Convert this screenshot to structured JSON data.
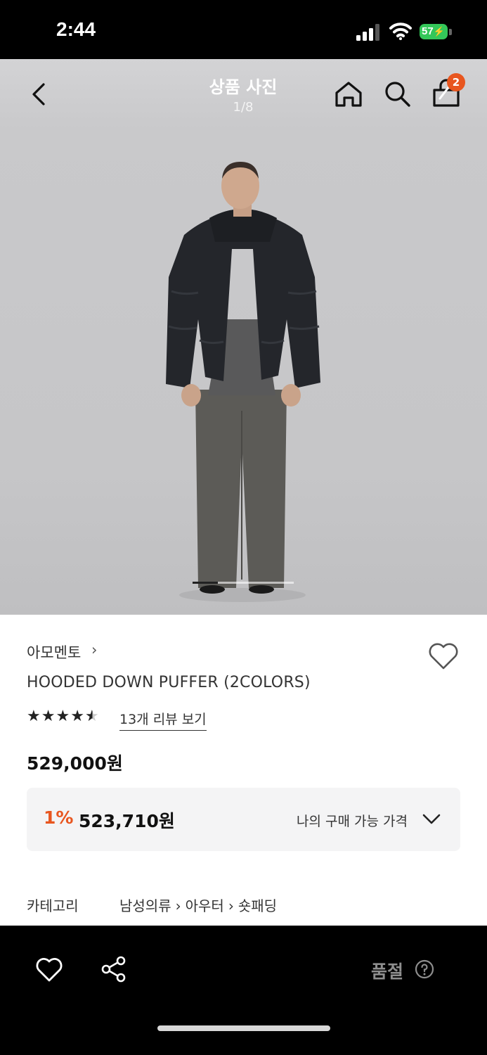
{
  "status": {
    "time": "2:44",
    "battery": "57"
  },
  "nav": {
    "title": "상품 사진",
    "page": "1/8",
    "cart_count": "2"
  },
  "product": {
    "brand": "아모멘토",
    "name": "HOODED DOWN PUFFER (2COLORS)",
    "rating": 4.5,
    "stars": "★★★★★",
    "review_link": "13개 리뷰 보기",
    "price": "529,000원",
    "discount_rate": "1%",
    "discount_price": "523,710원",
    "my_price_label": "나의 구매 가능 가격",
    "category_label": "카테고리",
    "breadcrumb": [
      "남성의류",
      "아우터",
      "숏패딩"
    ]
  },
  "carousel": {
    "current": 1,
    "total": 8
  },
  "bottom": {
    "soldout_label": "품절"
  },
  "colors": {
    "accent": "#e8561f",
    "battery": "#34c759",
    "background": "#c8c8ca"
  }
}
